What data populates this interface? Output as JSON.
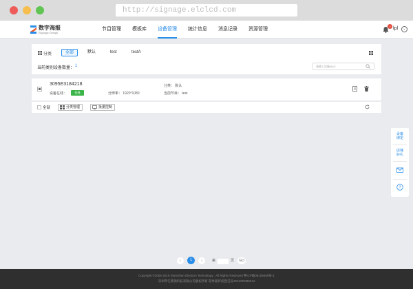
{
  "browser": {
    "url": "http://signage.elclcd.com"
  },
  "header": {
    "logo_title": "数字海报",
    "logo_subtitle": "Signage Design",
    "nav": [
      {
        "label": "节目管理",
        "active": false
      },
      {
        "label": "模板库",
        "active": false
      },
      {
        "label": "设备管理",
        "active": true
      },
      {
        "label": "统计信息",
        "active": false
      },
      {
        "label": "消息记录",
        "active": false
      },
      {
        "label": "资源管理",
        "active": false
      }
    ],
    "notification_count": "2",
    "user_name": "lpl"
  },
  "filter": {
    "category_label": "分类",
    "chips": [
      "全部",
      "默认",
      "test",
      "testA"
    ],
    "count_label": "当前类别设备数量：",
    "count_value": "1",
    "search_placeholder": "请输入设备MAC"
  },
  "device": {
    "id": "3095E3184218",
    "status_label": "设备在线：",
    "status_value": "在线",
    "resolution": "分辨率： 1920*1080",
    "category": "分类： 默认",
    "current_program": "当前节目： test"
  },
  "actions": {
    "select_all": "全部",
    "category_manage": "分类管理",
    "batch_control": "批量控制"
  },
  "float_panel": {
    "item1": [
      "设备",
      "绑定"
    ],
    "item2": [
      "店铺",
      "好礼"
    ]
  },
  "pagination": {
    "current_page": "1",
    "page_label": "第",
    "page_suffix": "页",
    "go_label": "GO"
  },
  "footer": {
    "line1": "Copyright ©2006-2019 Shenzhen Electron Technology , All Rights Reserved 粤ICP备08159408号-1",
    "line2": "深圳市亿莱顿科技有限公司版权所有 软件著作权登记号2016SR088244"
  },
  "colors": {
    "accent": "#2a8de8",
    "online": "#3bb54a",
    "badge": "#e2483a",
    "footer_bg": "#2f2f2f"
  }
}
